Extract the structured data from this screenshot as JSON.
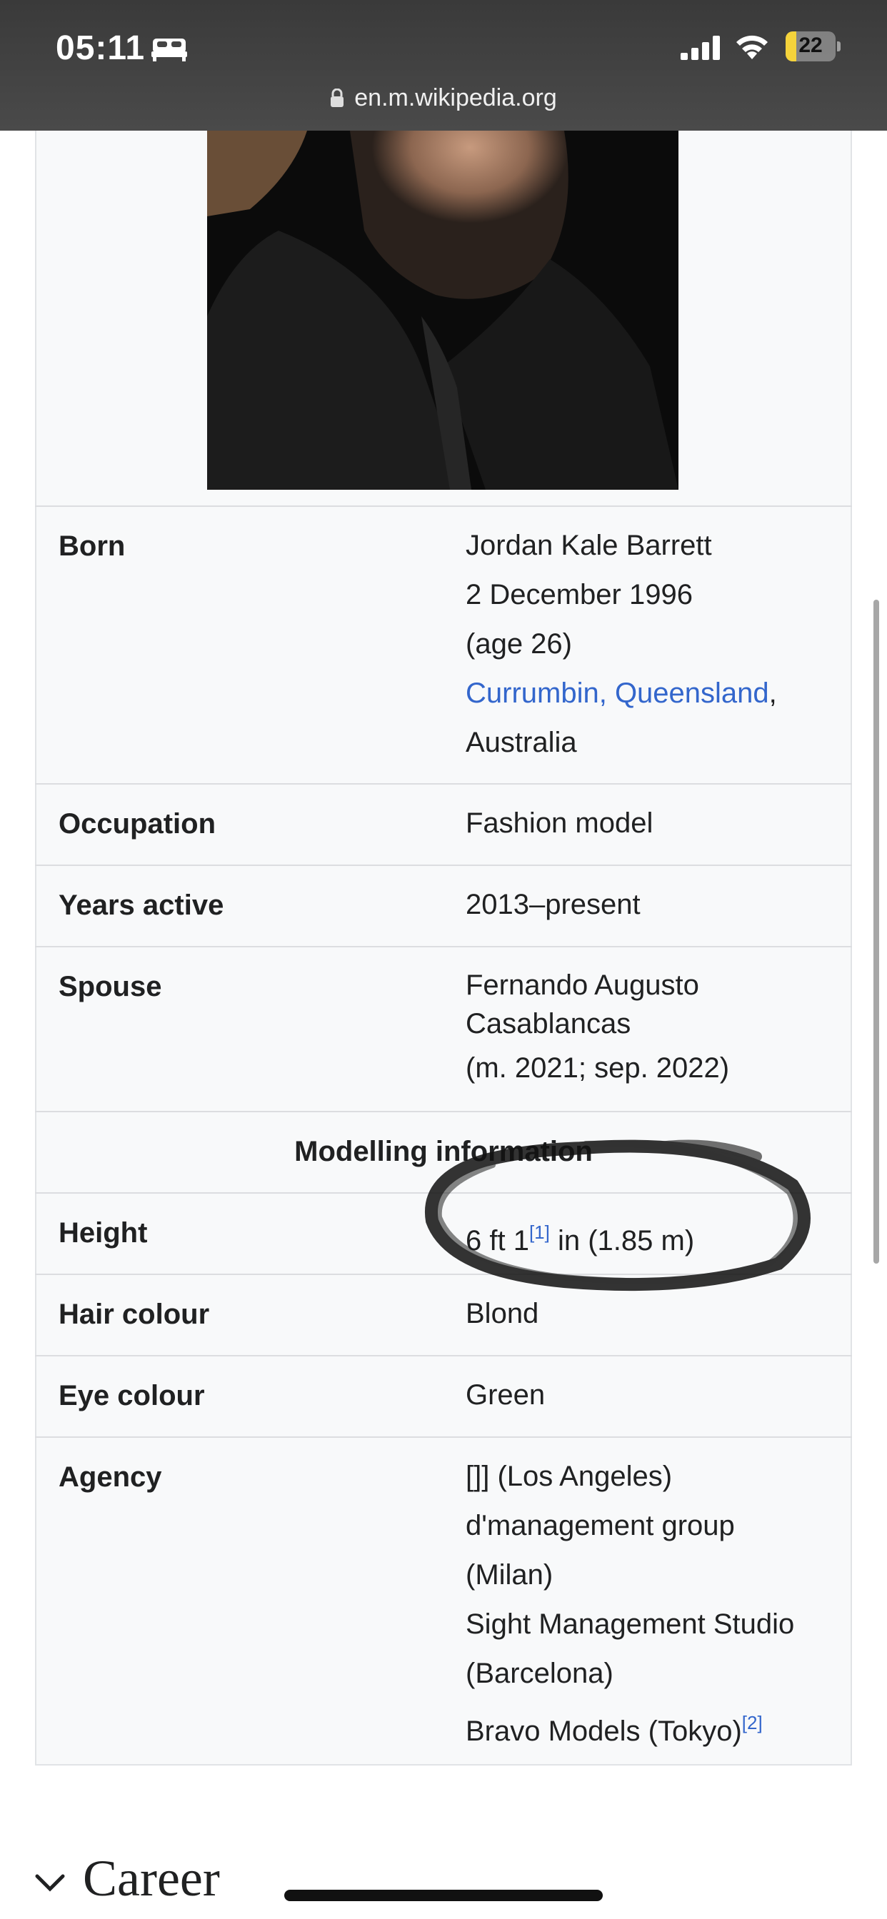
{
  "status_bar": {
    "time": "05:11",
    "battery_level": "22",
    "battery_fraction": 0.22,
    "battery_color": "#f5d33b"
  },
  "url_bar": {
    "url": "en.m.wikipedia.org"
  },
  "infobox": {
    "rows": [
      {
        "label": "Born",
        "lines": [
          "Jordan Kale Barrett",
          "2 December 1996",
          "(age 26)"
        ],
        "birthplace_link": "Currumbin, Queensland",
        "birthplace_suffix": ",",
        "country": "Australia"
      },
      {
        "label": "Occupation",
        "value": "Fashion model"
      },
      {
        "label": "Years active",
        "value": "2013–present"
      },
      {
        "label": "Spouse",
        "lines": [
          "Fernando Augusto",
          "Casablancas",
          "(m. 2021; sep. 2022)"
        ]
      }
    ],
    "section_header": "Modelling information",
    "modelling_rows": [
      {
        "label": "Height",
        "value_prefix": "6 ft 1",
        "ref": "[1]",
        "value_suffix": " in (1.85 m)"
      },
      {
        "label": "Hair colour",
        "value": "Blond"
      },
      {
        "label": "Eye colour",
        "value": "Green"
      },
      {
        "label": "Agency",
        "lines": [
          "[]] (Los Angeles)",
          "d'management group",
          "(Milan)",
          "Sight Management Studio",
          "(Barcelona)",
          "Bravo Models (Tokyo)"
        ],
        "ref": "[2]"
      }
    ]
  },
  "section": {
    "title": "Career"
  },
  "colors": {
    "link": "#3366cc",
    "infobox_bg": "#f8f9fa",
    "text": "#202122"
  }
}
